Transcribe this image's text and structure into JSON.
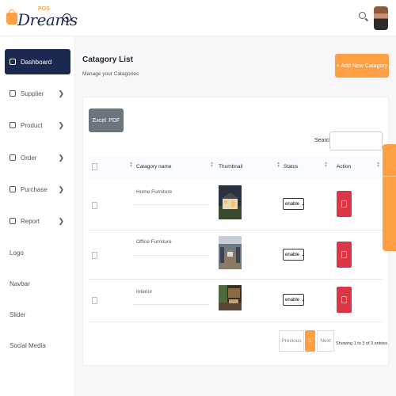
{
  "header": {
    "logo_text": "Dreams",
    "logo_badge": "POS"
  },
  "sidebar": {
    "items": [
      {
        "label": "Dashboard",
        "active": true,
        "icon": "dashboard-icon"
      },
      {
        "label": "Supplier",
        "icon": "supplier-icon"
      },
      {
        "label": "Product",
        "icon": "product-icon"
      },
      {
        "label": "Order",
        "icon": "cart-icon"
      },
      {
        "label": "Purchase",
        "icon": "purchase-icon"
      },
      {
        "label": "Report",
        "icon": "report-icon"
      },
      {
        "label": "Logo"
      },
      {
        "label": "Navbar"
      },
      {
        "label": "Slider"
      },
      {
        "label": "Social Media"
      }
    ],
    "arrow": "❯"
  },
  "page": {
    "title": "Catagory List",
    "subtitle": "Manage your Catagories",
    "add_button": "+ Add New Catagory"
  },
  "toolbar": {
    "excel": "Excel",
    "pdf": "PDF",
    "search_label": "Search:"
  },
  "table": {
    "headers": {
      "name": "Catagory name",
      "thumbnail": "Thumbnail",
      "status": "Status",
      "action": "Action"
    },
    "rows": [
      {
        "name": "Home Furniture",
        "status": "enable"
      },
      {
        "name": "Office Furniture",
        "status": "enable"
      },
      {
        "name": "Interior",
        "status": "enable"
      }
    ]
  },
  "pagination": {
    "previous": "Previous",
    "current": "1",
    "next": "Next",
    "info": "Showing 1 to 3 of 3 entries"
  },
  "colors": {
    "accent": "#ff9f43",
    "sidebar_active": "#1b2850",
    "delete": "#dc3545"
  }
}
